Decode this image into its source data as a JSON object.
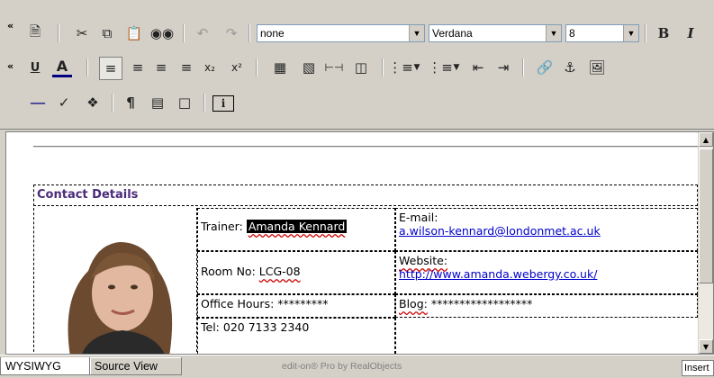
{
  "toolbar": {
    "style_select": "none",
    "font_select": "Verdana",
    "size_select": "8"
  },
  "contact": {
    "heading": "Contact Details",
    "trainer_label": "Trainer:",
    "trainer_name": "Amanda Kennard",
    "email_label": "E-mail:",
    "email_value": "a.wilson-kennard@londonmet.ac.uk",
    "room_label": "Room No:",
    "room_value": "LCG-08",
    "website_label": "Website:",
    "website_value": "http://www.amanda.webergy.co.uk/",
    "office_label": "Office Hours:",
    "office_value": "*********",
    "blog_label": "Blog:",
    "blog_value": "******************",
    "tel_label": "Tel:",
    "tel_value": "020 7133 2340"
  },
  "bottom": {
    "tab_wysiwyg": "WYSIWYG",
    "tab_source": "Source View",
    "status": "edit-on® Pro by RealObjects",
    "mode": "Insert"
  },
  "colors": {
    "heading": "#4b2a7a",
    "link": "#0000cc",
    "chrome": "#d4d0c8"
  }
}
